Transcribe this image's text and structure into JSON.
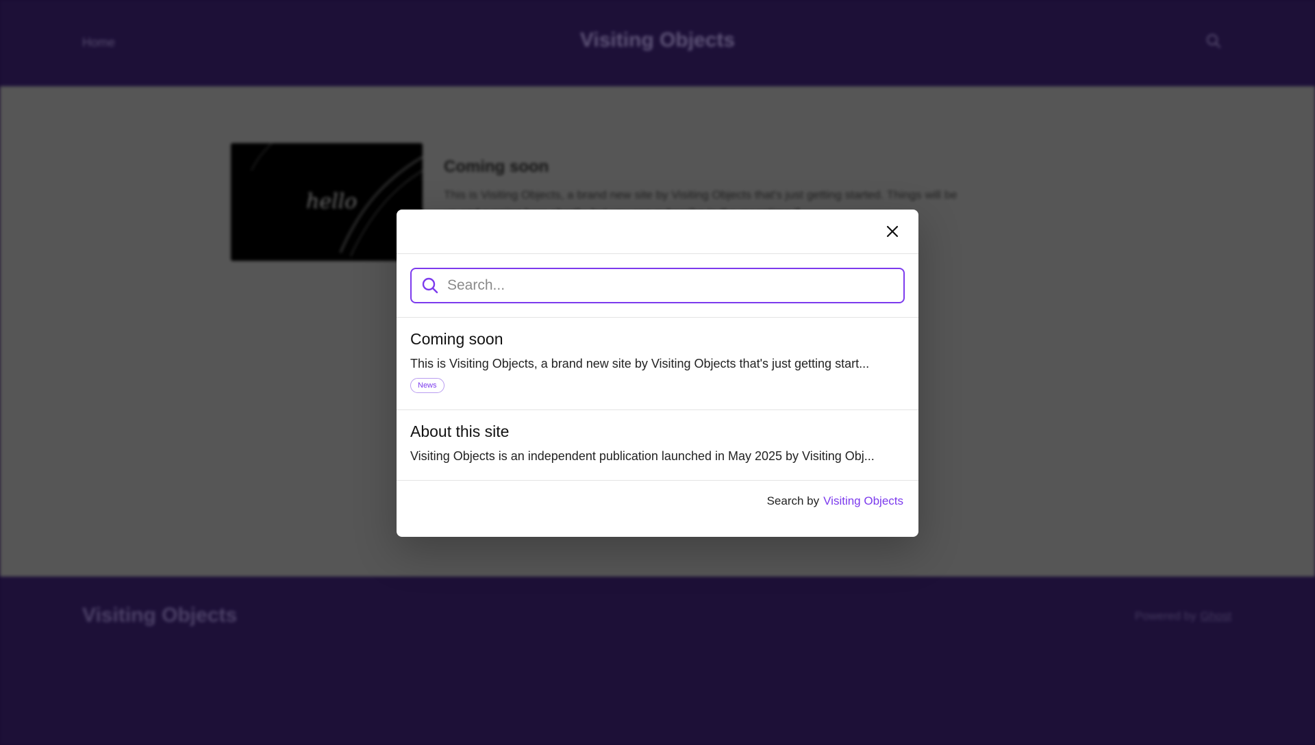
{
  "header": {
    "nav_home": "Home",
    "site_title": "Visiting Objects"
  },
  "post": {
    "thumbnail_text": "hello",
    "title": "Coming soon",
    "excerpt": "This is Visiting Objects, a brand new site by Visiting Objects that's just getting started. Things will be up and running here shortly, but you can subscribe in the meantime if..."
  },
  "footer": {
    "site_title": "Visiting Objects",
    "powered_by": "Powered by",
    "powered_link": "Ghost"
  },
  "search_modal": {
    "placeholder": "Search...",
    "value": "",
    "results": [
      {
        "title": "Coming soon",
        "excerpt": "This is Visiting Objects, a brand new site by Visiting Objects that's just getting start...",
        "tag": "News"
      },
      {
        "title": "About this site",
        "excerpt": "Visiting Objects is an independent publication launched in May 2025 by Visiting Obj..."
      }
    ],
    "footer_label": "Search by",
    "footer_link": "Visiting Objects"
  },
  "colors": {
    "accent": "#7c3aed",
    "header_bg": "#2f1a5a"
  },
  "icons": [
    "search-icon",
    "close-icon"
  ]
}
